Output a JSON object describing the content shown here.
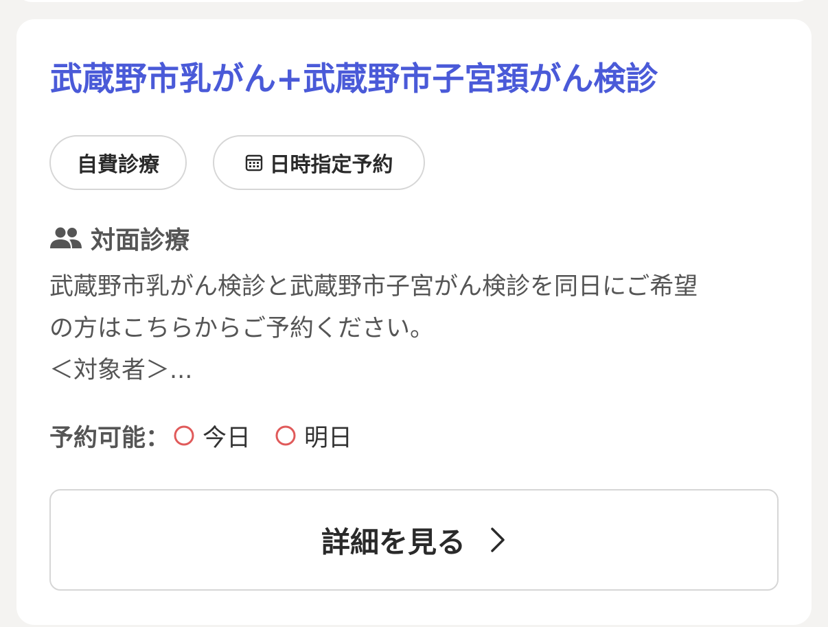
{
  "card": {
    "title": "武蔵野市乳がん+武蔵野市子宮頚がん検診",
    "tags": [
      {
        "label": "自費診療",
        "icon": null
      },
      {
        "label": "日時指定予約",
        "icon": "calendar-icon"
      }
    ],
    "consultation": {
      "icon": "people-icon",
      "label": "対面診療"
    },
    "description_lines": [
      "武蔵野市乳がん検診と武蔵野市子宮がん検診を同日にご希望",
      "の方はこちらからご予約ください。",
      "＜対象者＞..."
    ],
    "availability": {
      "label": "予約可能：",
      "days": [
        {
          "mark": "circle-icon",
          "label": "今日"
        },
        {
          "mark": "circle-icon",
          "label": "明日"
        }
      ]
    },
    "detail_button": {
      "label": "詳細を見る"
    }
  },
  "colors": {
    "accent": "#4a5ad8",
    "available_circle": "#e05a5a",
    "border": "#d6d6d6",
    "background": "#f4f3f1"
  }
}
